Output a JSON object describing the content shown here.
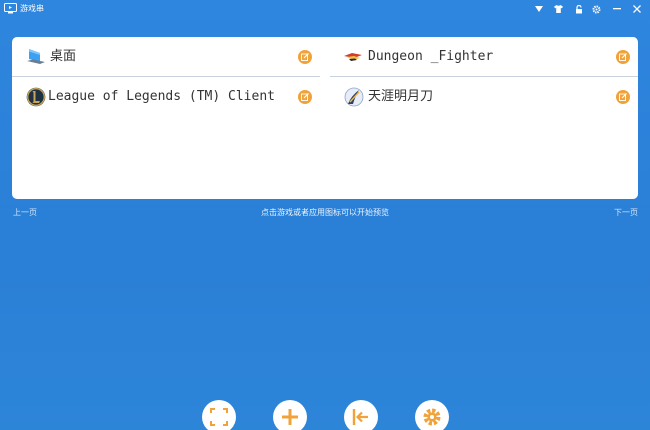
{
  "window": {
    "title": "游戏串",
    "controls": [
      "dropdown-icon",
      "shirt-icon",
      "lock-icon",
      "settings-icon",
      "minimize-icon",
      "close-icon"
    ]
  },
  "windows": [
    {
      "label": "桌面",
      "icon": "desktop-icon"
    },
    {
      "label": "Dungeon _Fighter",
      "icon": "dungeon-fighter-icon"
    },
    {
      "label": "League of Legends (TM) Client",
      "icon": "league-of-legends-icon"
    },
    {
      "label": "天涯明月刀",
      "icon": "tianya-mingyuedao-icon"
    }
  ],
  "pager": {
    "prev": "上一页",
    "hint": "点击游戏或者应用图标可以开始预览",
    "next": "下一页"
  },
  "toolbar": {
    "buttons": [
      "capture-icon",
      "add-icon",
      "exit-icon",
      "gear-icon"
    ]
  },
  "colors": {
    "background": "#2f86de",
    "accent": "#f0a33a",
    "panel": "#ffffff"
  }
}
